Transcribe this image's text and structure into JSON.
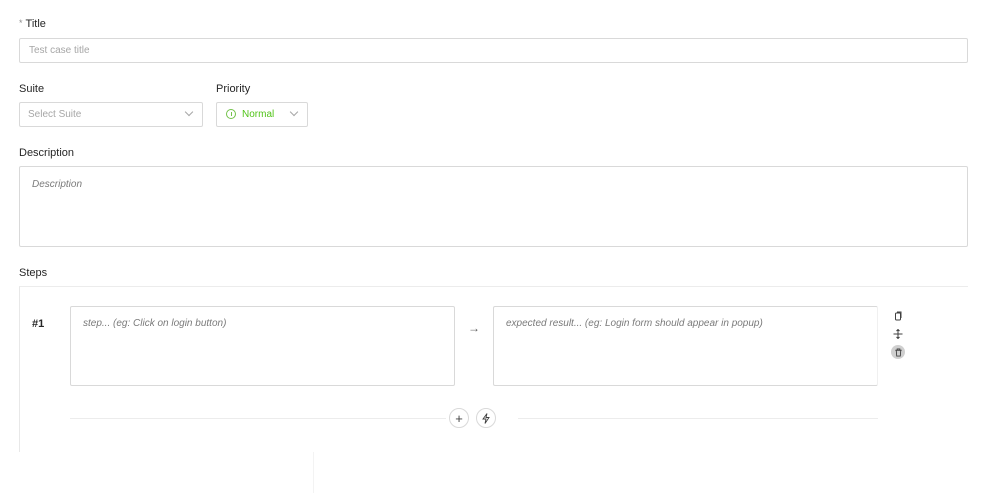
{
  "title": {
    "required_mark": "*",
    "label": "Title",
    "placeholder": "Test case title"
  },
  "suite": {
    "label": "Suite",
    "placeholder": "Select Suite"
  },
  "priority": {
    "label": "Priority",
    "value": "Normal",
    "color": "#52c41a"
  },
  "description": {
    "label": "Description",
    "placeholder": "Description"
  },
  "steps": {
    "label": "Steps",
    "items": [
      {
        "number": "#1",
        "step_placeholder": "step... (eg: Click on login button)",
        "expected_placeholder": "expected result... (eg: Login form should appear in popup)"
      }
    ],
    "icons": {
      "copy": "copy-icon",
      "move": "drag-move-icon",
      "delete": "trash-icon",
      "add": "plus-icon",
      "generate": "lightning-icon"
    }
  }
}
